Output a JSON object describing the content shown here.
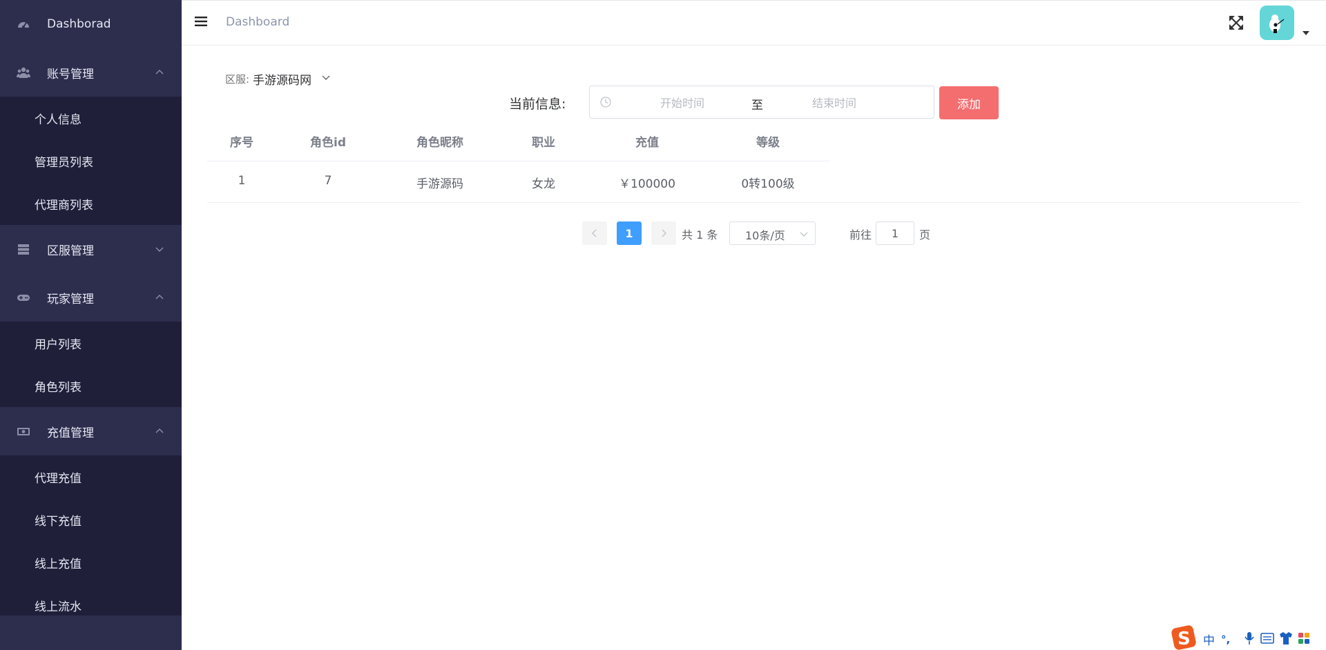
{
  "sidebar": {
    "dashboard": "Dashborad",
    "account": {
      "label": "账号管理",
      "items": [
        "个人信息",
        "管理员列表",
        "代理商列表"
      ]
    },
    "server": {
      "label": "区服管理"
    },
    "player": {
      "label": "玩家管理",
      "items": [
        "用户列表",
        "角色列表"
      ]
    },
    "recharge": {
      "label": "充值管理",
      "items": [
        "代理充值",
        "线下充值",
        "线上充值",
        "线上流水"
      ]
    }
  },
  "header": {
    "title": "Dashboard"
  },
  "filter": {
    "server_label": "区服:",
    "server_value": "手游源码网",
    "info_label": "当前信息:",
    "start_placeholder": "开始时间",
    "separator": "至",
    "end_placeholder": "结束时间",
    "add_button": "添加"
  },
  "table": {
    "columns": [
      "序号",
      "角色id",
      "角色昵称",
      "职业",
      "充值",
      "等级"
    ],
    "rows": [
      [
        "1",
        "7",
        "手游源码",
        "女龙",
        "￥100000",
        "0转100级"
      ]
    ]
  },
  "pagination": {
    "current_page": "1",
    "total": "共 1 条",
    "page_size": "10条/页",
    "goto_label": "前往",
    "goto_value": "1",
    "page_unit": "页"
  },
  "ime": {
    "lang": "中",
    "punct": "°,"
  },
  "colors": {
    "sidebar_bg": "#2d2e4e",
    "submenu_bg": "#1f1f3a",
    "accent_blue": "#409eff",
    "add_button": "#f46d6f",
    "avatar_bg": "#64d6d8"
  }
}
